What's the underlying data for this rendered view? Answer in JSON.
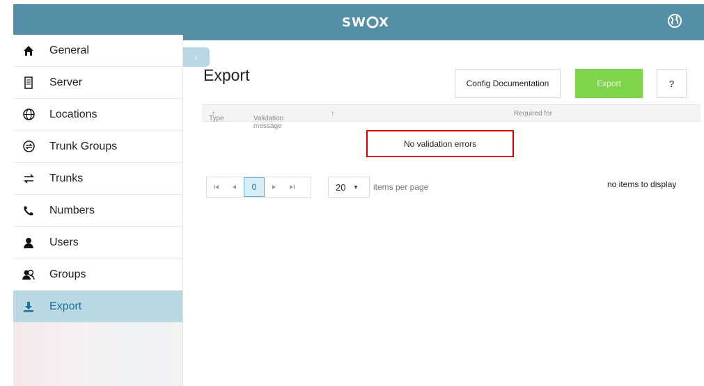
{
  "header": {
    "logo_text": "SW⌾X",
    "accent_color": "#548ea7",
    "globe_icon": "globe-icon"
  },
  "sidebar": {
    "items": [
      {
        "label": "General",
        "icon": "home-icon"
      },
      {
        "label": "Server",
        "icon": "server-icon"
      },
      {
        "label": "Locations",
        "icon": "globe-icon"
      },
      {
        "label": "Trunk Groups",
        "icon": "trunk-group-icon"
      },
      {
        "label": "Trunks",
        "icon": "arrows-icon"
      },
      {
        "label": "Numbers",
        "icon": "phone-icon"
      },
      {
        "label": "Users",
        "icon": "user-icon"
      },
      {
        "label": "Groups",
        "icon": "group-icon"
      },
      {
        "label": "Export",
        "icon": "download-icon",
        "active": true
      }
    ],
    "active_color": "#b8d8e2"
  },
  "main": {
    "title": "Export",
    "buttons": {
      "config_doc": "Config Documentation",
      "export": "Export",
      "help": "?"
    },
    "export_color": "#7fd44a",
    "grid": {
      "columns": [
        "Type",
        "Validation message",
        "Required for"
      ],
      "sort_indicator": "↑",
      "empty_message": "No validation errors"
    },
    "pager": {
      "first": "⏮",
      "prev": "◀",
      "current_page": "0",
      "next": "▶",
      "last": "⏭",
      "page_size": "20",
      "items_per_page_label": "items per page",
      "status": "no items to display"
    }
  }
}
